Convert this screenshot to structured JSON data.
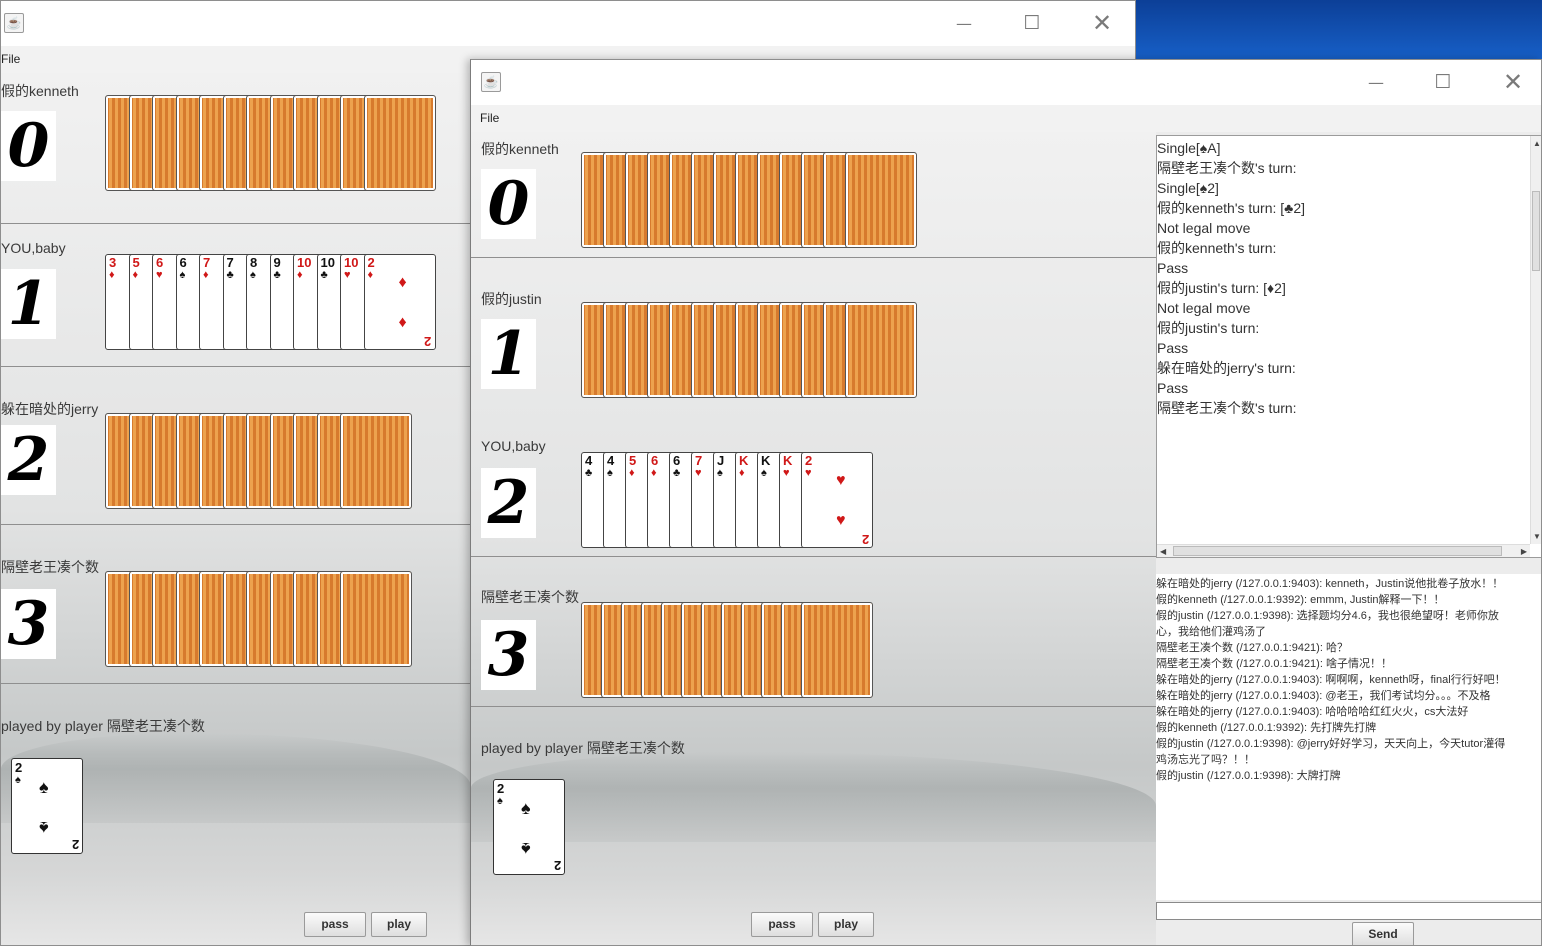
{
  "window1": {
    "menu_file": "File",
    "players": [
      {
        "name": "假的kenneth",
        "avatar": "0"
      },
      {
        "name": "YOU,baby",
        "avatar": "1"
      },
      {
        "name": "躲在暗处的jerry",
        "avatar": "2"
      },
      {
        "name": "隔壁老王凑个数",
        "avatar": "3"
      }
    ],
    "hand_cards": [
      {
        "rank": "3",
        "suit": "♦",
        "color": "red"
      },
      {
        "rank": "5",
        "suit": "♦",
        "color": "red"
      },
      {
        "rank": "6",
        "suit": "♥",
        "color": "red"
      },
      {
        "rank": "6",
        "suit": "♠",
        "color": "black"
      },
      {
        "rank": "7",
        "suit": "♦",
        "color": "red"
      },
      {
        "rank": "7",
        "suit": "♣",
        "color": "black"
      },
      {
        "rank": "8",
        "suit": "♠",
        "color": "black"
      },
      {
        "rank": "9",
        "suit": "♣",
        "color": "black"
      },
      {
        "rank": "10",
        "suit": "♦",
        "color": "red"
      },
      {
        "rank": "10",
        "suit": "♣",
        "color": "black"
      },
      {
        "rank": "10",
        "suit": "♥",
        "color": "red"
      },
      {
        "rank": "2",
        "suit": "♦",
        "color": "red"
      }
    ],
    "played_label": "played by player 隔壁老王凑个数",
    "played_card": {
      "rank": "2",
      "suit": "♠"
    },
    "pass_label": "pass",
    "play_label": "play"
  },
  "window2": {
    "menu_file": "File",
    "players": [
      {
        "name": "假的kenneth",
        "avatar": "0"
      },
      {
        "name": "假的justin",
        "avatar": "1"
      },
      {
        "name": "YOU,baby",
        "avatar": "2"
      },
      {
        "name": "隔壁老王凑个数",
        "avatar": "3"
      }
    ],
    "hand_cards": [
      {
        "rank": "4",
        "suit": "♣",
        "color": "black"
      },
      {
        "rank": "4",
        "suit": "♠",
        "color": "black"
      },
      {
        "rank": "5",
        "suit": "♦",
        "color": "red"
      },
      {
        "rank": "6",
        "suit": "♦",
        "color": "red"
      },
      {
        "rank": "6",
        "suit": "♣",
        "color": "black"
      },
      {
        "rank": "7",
        "suit": "♥",
        "color": "red"
      },
      {
        "rank": "J",
        "suit": "♠",
        "color": "black"
      },
      {
        "rank": "K",
        "suit": "♦",
        "color": "red"
      },
      {
        "rank": "K",
        "suit": "♠",
        "color": "black"
      },
      {
        "rank": "K",
        "suit": "♥",
        "color": "red"
      },
      {
        "rank": "2",
        "suit": "♥",
        "color": "red"
      }
    ],
    "played_label": "played by player 隔壁老王凑个数",
    "played_card": {
      "rank": "2",
      "suit": "♠"
    },
    "pass_label": "pass",
    "play_label": "play",
    "game_log": [
      "Single[♠A]",
      "隔壁老王凑个数's turn:",
      "Single[♠2]",
      "假的kenneth's turn: [♣2]",
      "Not legal move",
      "假的kenneth's turn:",
      "Pass",
      "假的justin's turn: [♦2]",
      "Not legal move",
      "假的justin's turn:",
      "Pass",
      "躲在暗处的jerry's turn:",
      "Pass",
      "隔壁老王凑个数's turn:"
    ],
    "chat": [
      "躲在暗处的jerry (/127.0.0.1:9403): kenneth，Justin说他批卷子放水！！",
      "假的kenneth (/127.0.0.1:9392): emmm, Justin解释一下！！",
      "假的justin (/127.0.0.1:9398): 选择题均分4.6，我也很绝望呀！老师你放",
      "心，我给他们灌鸡汤了",
      "隔壁老王凑个数 (/127.0.0.1:9421): 哈？",
      "隔壁老王凑个数 (/127.0.0.1:9421): 啥子情况！！",
      "躲在暗处的jerry (/127.0.0.1:9403): 啊啊啊，kenneth呀，final行行好吧！",
      "躲在暗处的jerry (/127.0.0.1:9403): @老王，我们考试均分。。。不及格",
      "躲在暗处的jerry (/127.0.0.1:9403): 哈哈哈哈红红火火，cs大法好",
      "假的kenneth (/127.0.0.1:9392): 先打牌先打牌",
      "假的justin (/127.0.0.1:9398): @jerry好好学习，天天向上，今天tutor灌得",
      "鸡汤忘光了吗？！！",
      "假的justin (/127.0.0.1:9398): 大牌打牌"
    ],
    "chat_input": "",
    "send_label": "Send"
  }
}
